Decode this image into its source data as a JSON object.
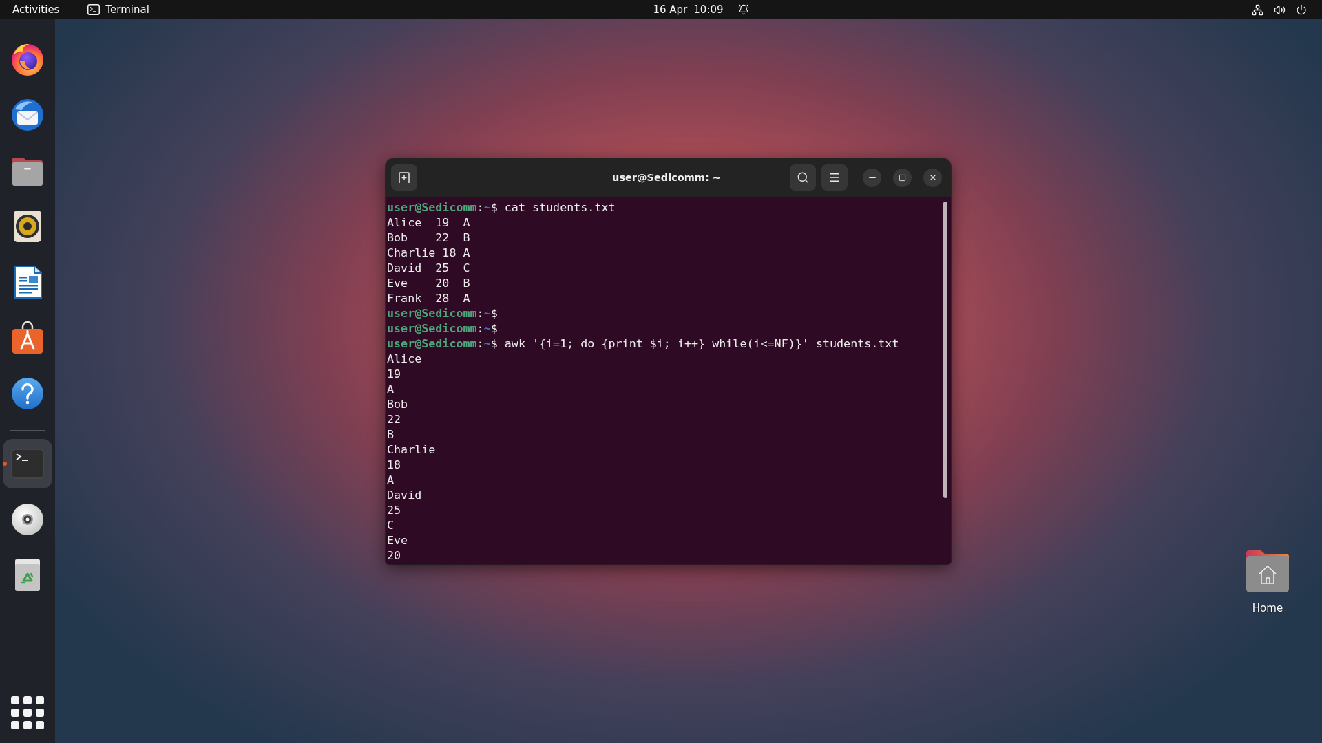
{
  "top_bar": {
    "activities": "Activities",
    "app_menu": "Terminal",
    "clock": {
      "date": "16 Apr",
      "time": "10:09"
    }
  },
  "dock": {
    "favorites": [
      {
        "running": false,
        "selected": false
      },
      {
        "running": false,
        "selected": false
      },
      {
        "running": false,
        "selected": false
      },
      {
        "running": false,
        "selected": false
      },
      {
        "running": false,
        "selected": false
      },
      {
        "running": false,
        "selected": false
      },
      {
        "running": false,
        "selected": false
      }
    ],
    "extra": [
      {
        "running": true,
        "selected": true
      },
      {
        "running": false,
        "selected": false
      },
      {
        "running": false,
        "selected": false
      }
    ]
  },
  "terminal": {
    "title": "user@Sedicomm: ~",
    "lines": [
      {
        "kind": "prompt",
        "user": "user@Sedicomm",
        "separator": ":",
        "path": "~",
        "sign": "$",
        "command": "cat students.txt"
      },
      {
        "kind": "output",
        "text": "Alice  19  A"
      },
      {
        "kind": "output",
        "text": "Bob    22  B"
      },
      {
        "kind": "output",
        "text": "Charlie 18 A"
      },
      {
        "kind": "output",
        "text": "David  25  C"
      },
      {
        "kind": "output",
        "text": "Eve    20  B"
      },
      {
        "kind": "output",
        "text": "Frank  28  A"
      },
      {
        "kind": "prompt",
        "user": "user@Sedicomm",
        "separator": ":",
        "path": "~",
        "sign": "$"
      },
      {
        "kind": "prompt",
        "user": "user@Sedicomm",
        "separator": ":",
        "path": "~",
        "sign": "$"
      },
      {
        "kind": "prompt",
        "user": "user@Sedicomm",
        "separator": ":",
        "path": "~",
        "sign": "$",
        "command": "awk '{i=1; do {print $i; i++} while(i<=NF)}' students.txt"
      },
      {
        "kind": "output",
        "text": "Alice"
      },
      {
        "kind": "output",
        "text": "19"
      },
      {
        "kind": "output",
        "text": "A"
      },
      {
        "kind": "output",
        "text": "Bob"
      },
      {
        "kind": "output",
        "text": "22"
      },
      {
        "kind": "output",
        "text": "B"
      },
      {
        "kind": "output",
        "text": "Charlie"
      },
      {
        "kind": "output",
        "text": "18"
      },
      {
        "kind": "output",
        "text": "A"
      },
      {
        "kind": "output",
        "text": "David"
      },
      {
        "kind": "output",
        "text": "25"
      },
      {
        "kind": "output",
        "text": "C"
      },
      {
        "kind": "output",
        "text": "Eve"
      },
      {
        "kind": "output",
        "text": "20"
      }
    ]
  },
  "desktop_icons": [
    {
      "label": "Home"
    }
  ]
}
